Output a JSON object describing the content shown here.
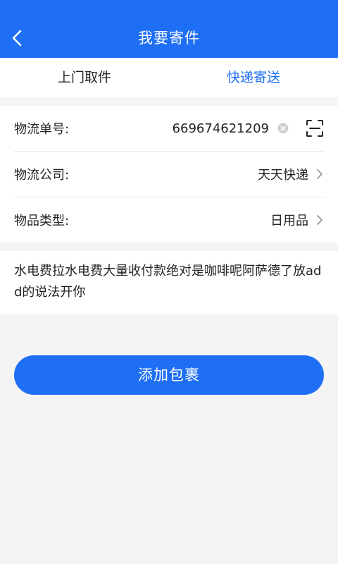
{
  "header": {
    "title": "我要寄件",
    "back_icon": "chevron-left-icon"
  },
  "tabs": [
    {
      "label": "上门取件",
      "active": false
    },
    {
      "label": "快递寄送",
      "active": true
    }
  ],
  "form": {
    "tracking": {
      "label": "物流单号:",
      "value": "669674621209",
      "clear_icon": "clear-circle-icon",
      "scan_icon": "scan-icon"
    },
    "company": {
      "label": "物流公司:",
      "value": "天天快递",
      "icon": "chevron-right-icon"
    },
    "category": {
      "label": "物品类型:",
      "value": "日用品",
      "icon": "chevron-right-icon"
    }
  },
  "note": {
    "text": "水电费拉水电费大量收付款绝对是咖啡呢阿萨德了放add的说法开你"
  },
  "actions": {
    "add_package_label": "添加包裹"
  },
  "colors": {
    "primary": "#1e6ff5",
    "background": "#f4f4f4",
    "divider": "#e6e6e6"
  }
}
